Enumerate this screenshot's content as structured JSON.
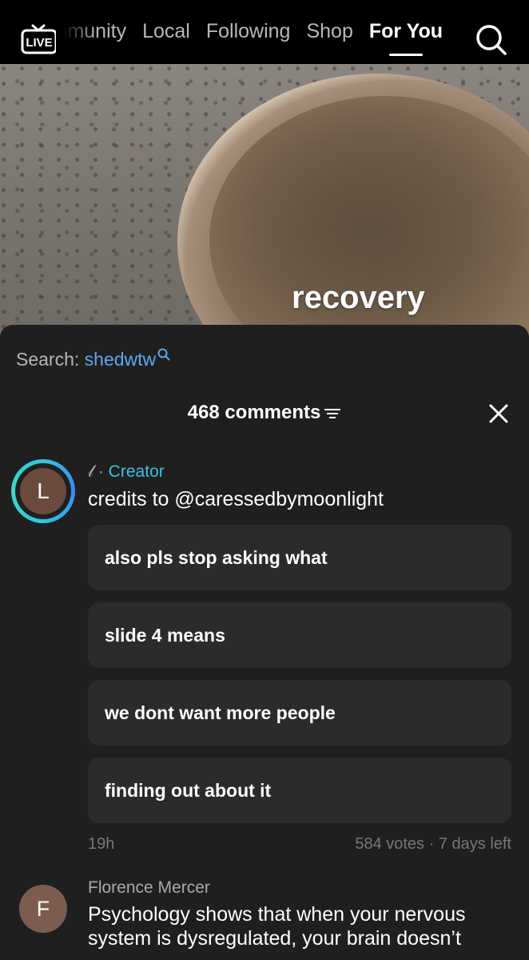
{
  "nav": {
    "live_label": "LIVE",
    "tabs": [
      {
        "label": "Community"
      },
      {
        "label": "Local"
      },
      {
        "label": "Following"
      },
      {
        "label": "Shop"
      },
      {
        "label": "For You"
      }
    ],
    "active_tab": "For You",
    "search_icon": "search-icon"
  },
  "video": {
    "overlay_text": "recovery"
  },
  "comments_panel": {
    "search_prefix": "Search:",
    "search_term": "shedwtw",
    "count_label": "468 comments",
    "sort_icon": "sort-icon",
    "close_icon": "close-icon",
    "creator_comment": {
      "avatar_letter": "L",
      "author_mark": "𝓁",
      "separator": "·",
      "creator_label": "Creator",
      "text": "credits to @caressedbymoonlight",
      "poll_options": [
        {
          "label": "also pls stop asking what"
        },
        {
          "label": "slide 4 means"
        },
        {
          "label": "we dont want more people"
        },
        {
          "label": "finding out about it"
        }
      ],
      "time": "19h",
      "votes_info": "584 votes · 7 days left"
    },
    "second_comment": {
      "avatar_letter": "F",
      "author": "Florence Mercer",
      "text": "Psychology shows that when your nervous system is dysregulated, your brain doesn’t"
    }
  },
  "colors": {
    "accent_blue": "#59a9f0",
    "creator_cyan": "#37c2e0",
    "sheet_bg": "#1f1f1f",
    "poll_bg": "#2b2b2b"
  }
}
